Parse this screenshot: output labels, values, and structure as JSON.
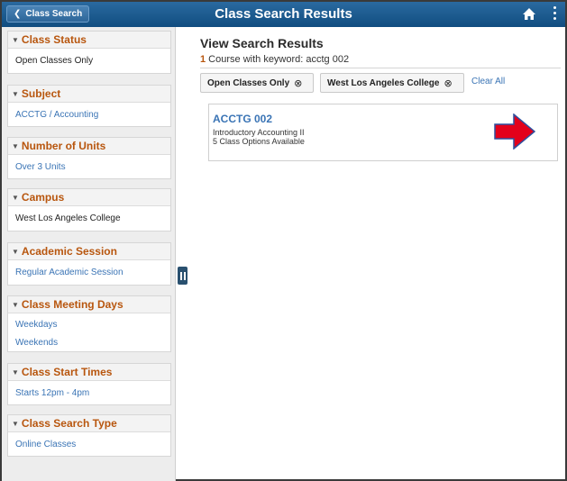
{
  "header": {
    "back_label": "Class Search",
    "title": "Class Search Results",
    "home_icon": "home-icon",
    "menu_icon": "kebab-icon",
    "bg_color": "#1a5a8e"
  },
  "sidebar": {
    "groups": [
      {
        "title": "Class Status",
        "items": [
          "Open Classes Only"
        ]
      },
      {
        "title": "Subject",
        "items": [
          "ACCTG / Accounting"
        ]
      },
      {
        "title": "Number of Units",
        "items": [
          "Over 3 Units"
        ]
      },
      {
        "title": "Campus",
        "items": [
          "West Los Angeles College"
        ]
      },
      {
        "title": "Academic Session",
        "items": [
          "Regular Academic Session"
        ]
      },
      {
        "title": "Class Meeting Days",
        "items": [
          "Weekdays",
          "Weekends"
        ]
      },
      {
        "title": "Class Start Times",
        "items": [
          "Starts 12pm - 4pm"
        ]
      },
      {
        "title": "Class Search Type",
        "items": [
          "Online Classes"
        ]
      }
    ],
    "heading_color": "#b8560e",
    "link_color": "#3a74b5"
  },
  "main": {
    "title": "View Search Results",
    "result_count": "1",
    "result_text": " Course with keyword: acctg 002",
    "chips": [
      "Open Classes Only",
      "West Los Angeles College"
    ],
    "chip_remove_glyph": "⊗",
    "clear_all": "Clear All",
    "course": {
      "code": "ACCTG 002",
      "title": "Introductory Accounting II",
      "options": "5 Class Options Available",
      "arrow_icon": "red-arrow-icon",
      "arrow_color": "#e3001b"
    }
  }
}
